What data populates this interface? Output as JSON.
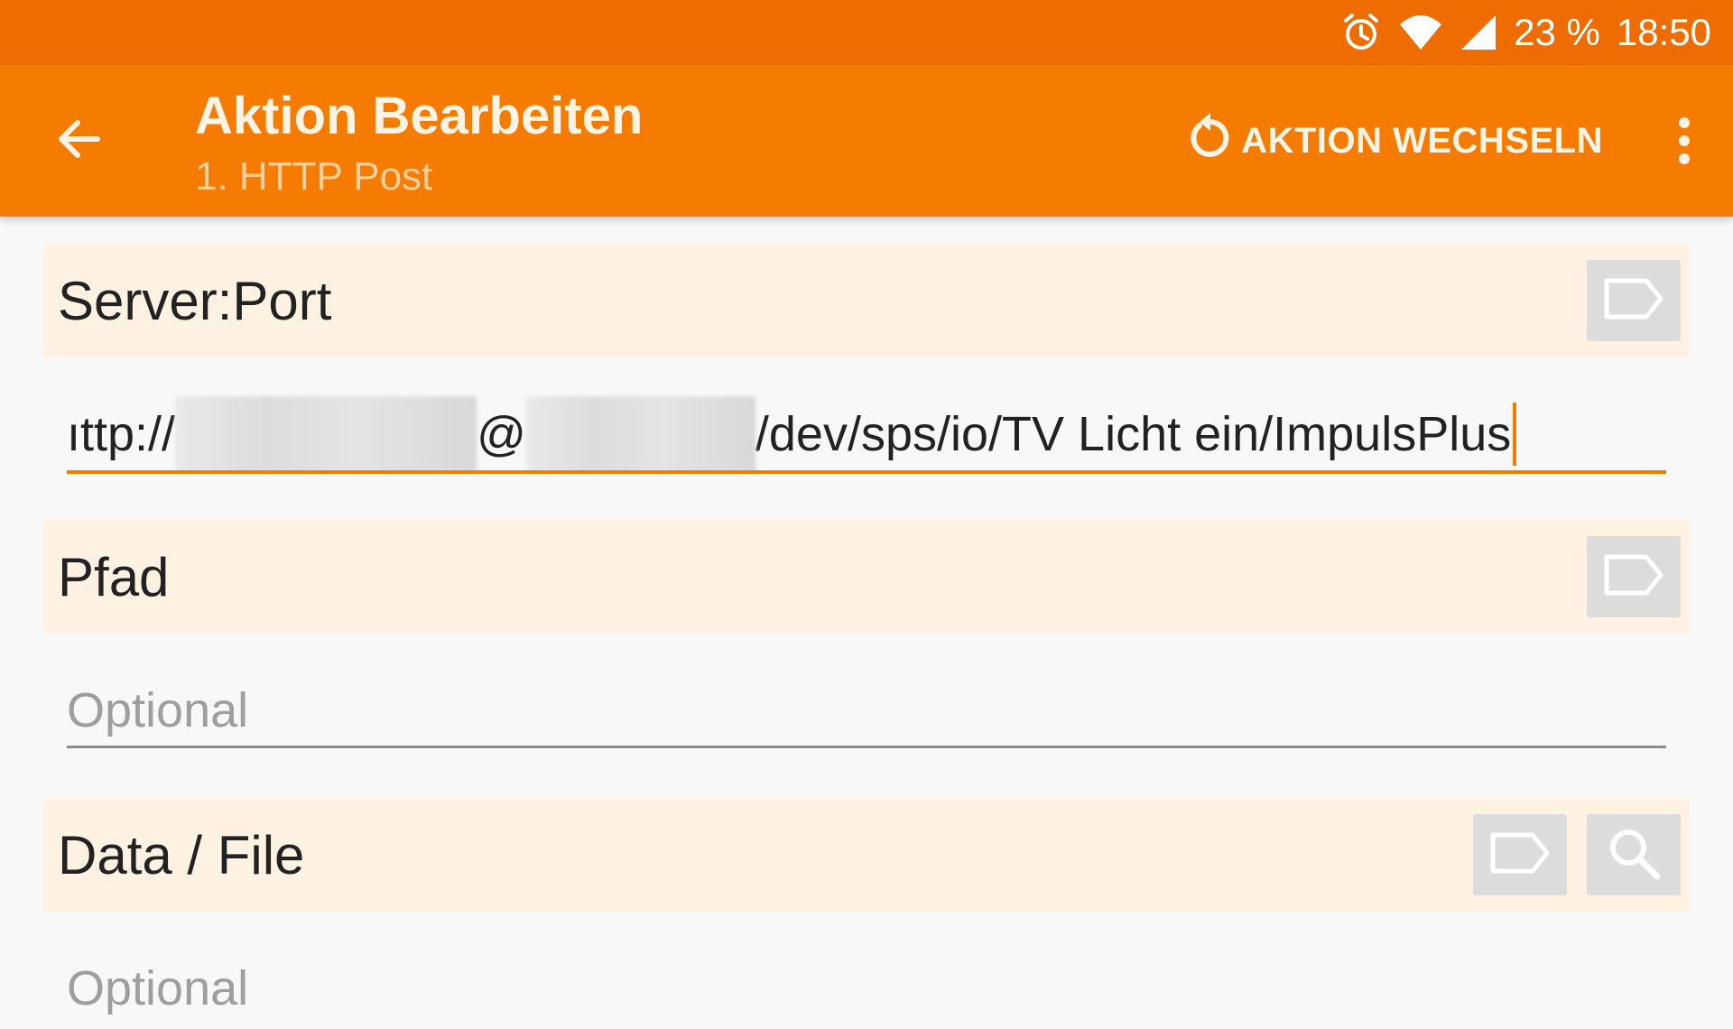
{
  "status": {
    "battery": "23 %",
    "time": "18:50"
  },
  "appbar": {
    "title": "Aktion Bearbeiten",
    "subtitle": "1. HTTP Post",
    "switch_label": "AKTION WECHSELN"
  },
  "sections": {
    "server_port": {
      "label": "Server:Port",
      "value_prefix": "ıttp://",
      "value_at": "@",
      "value_suffix": "/dev/sps/io/TV Licht ein/ImpulsPlus"
    },
    "pfad": {
      "label": "Pfad",
      "placeholder": "Optional"
    },
    "data_file": {
      "label": "Data / File",
      "placeholder": "Optional"
    }
  },
  "icons": {
    "back": "arrow-left-icon",
    "switch": "rotate-icon",
    "overflow": "more-vert-icon",
    "variable": "label-tag-icon",
    "search": "search-icon",
    "alarm": "alarm-icon",
    "wifi": "wifi-icon",
    "signal": "signal-icon"
  },
  "colors": {
    "statusbar": "#ee6c00",
    "appbar": "#f57c00",
    "section_bg": "#fff2e2",
    "accent": "#f57c00"
  }
}
